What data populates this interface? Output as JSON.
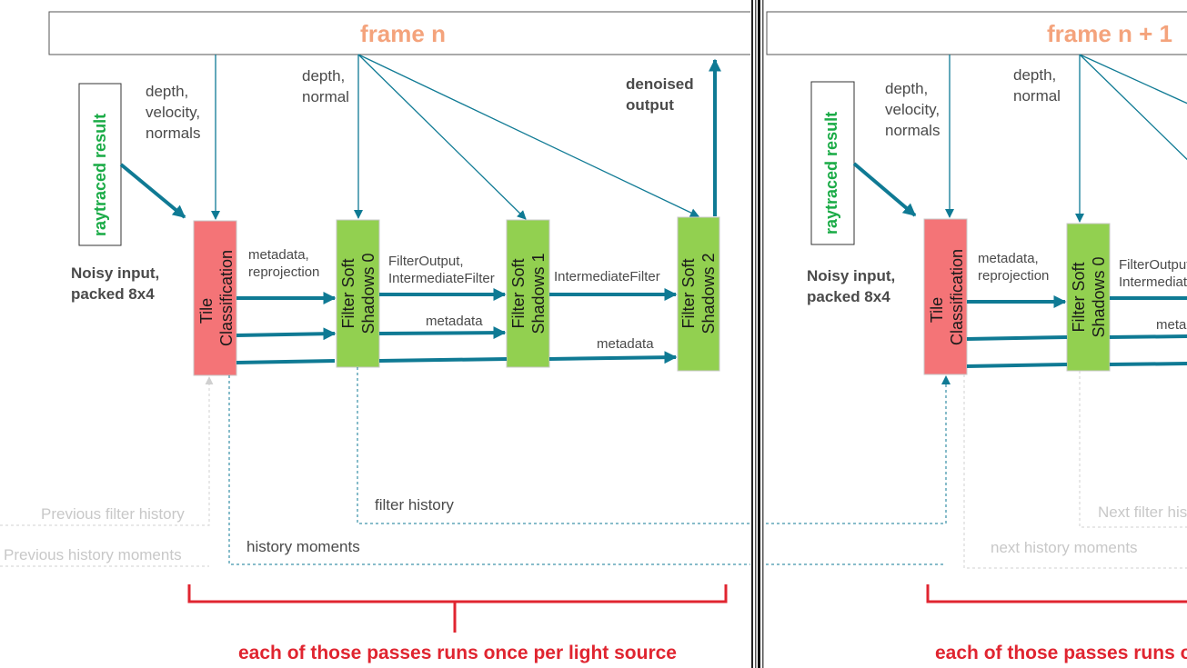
{
  "left": {
    "frame_title": "frame n",
    "raytraced": "raytraced result",
    "noisy_line1": "Noisy input,",
    "noisy_line2": "packed 8x4",
    "depth_vel_1": "depth,",
    "depth_vel_2": "velocity,",
    "depth_vel_3": "normals",
    "depth_norm_1": "depth,",
    "depth_norm_2": "normal",
    "denoised_1": "denoised",
    "denoised_2": "output",
    "tile_1": "Tile",
    "tile_2": "Classification",
    "fss0_1": "Filter Soft",
    "fss0_2": "Shadows 0",
    "fss1_1": "Filter Soft",
    "fss1_2": "Shadows 1",
    "fss2_1": "Filter Soft",
    "fss2_2": "Shadows 2",
    "meta_reproj_1": "metadata,",
    "meta_reproj_2": "reprojection",
    "filter_out_1": "FilterOutput,",
    "filter_out_2": "IntermediateFilter",
    "metadata_a": "metadata",
    "intermediate": "IntermediateFilter",
    "metadata_b": "metadata",
    "filter_history": "filter history",
    "history_moments": "history moments",
    "prev_filter_history": "Previous filter history",
    "prev_history_moments": "Previous history moments",
    "caption": "each of those passes runs once per light source"
  },
  "right": {
    "frame_title": "frame n + 1",
    "raytraced": "raytraced result",
    "noisy_line1": "Noisy input,",
    "noisy_line2": "packed 8x4",
    "depth_vel_1": "depth,",
    "depth_vel_2": "velocity,",
    "depth_vel_3": "normals",
    "depth_norm_1": "depth,",
    "depth_norm_2": "normal",
    "tile_1": "Tile",
    "tile_2": "Classification",
    "fss0_1": "Filter Soft",
    "fss0_2": "Shadows 0",
    "meta_reproj_1": "metadata,",
    "meta_reproj_2": "reprojection",
    "filter_out_1": "FilterOutput,",
    "filter_out_2": "IntermediateFilter",
    "metadata_a": "metadata",
    "next_filter_history": "Next filter history",
    "next_history_moments": "next history moments",
    "caption": "each of those passes runs once per light source"
  },
  "colors": {
    "arrow": "#0f7a94",
    "tile_fill": "#f47477",
    "filter_fill": "#92d050",
    "frame_title": "#f4a37c",
    "raytraced": "#1aab46",
    "caption": "#e02530",
    "ghost": "#c8c8c8"
  }
}
